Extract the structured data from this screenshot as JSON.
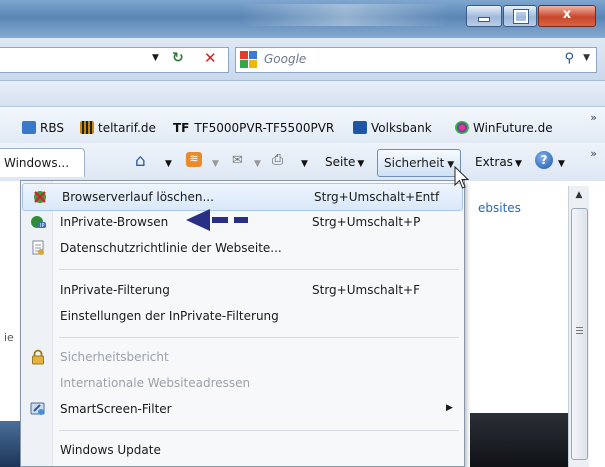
{
  "window": {
    "minimize_glyph": "—",
    "maximize_glyph": "□",
    "close_glyph": "x"
  },
  "address": {
    "refresh_icon": "refresh-icon",
    "stop_icon": "stop-icon"
  },
  "search": {
    "placeholder": "Google",
    "go_glyph": "⚲",
    "dropdown_glyph": "▼"
  },
  "favorites": {
    "items": [
      {
        "label": "RBS",
        "icon": "ie-page-icon",
        "color": "#3a78c9"
      },
      {
        "label": "teltarif.de",
        "icon": "teltarif-icon",
        "color": "#c68a12"
      },
      {
        "label": "TF5000PVR-TF5500PVR",
        "icon": "tf-icon",
        "prefix": "TF"
      },
      {
        "label": "Volksbank",
        "icon": "volksbank-icon",
        "color": "#1f55a6"
      },
      {
        "label": "WinFuture.de",
        "icon": "winfuture-icon",
        "color": "#7b3fa0"
      }
    ],
    "more_glyph": "»"
  },
  "command_bar": {
    "tab_label": "Windows...",
    "seite": "Seite",
    "sicherheit": "Sicherheit",
    "extras": "Extras",
    "more_glyph": "»"
  },
  "page": {
    "partial_text": "ebsites",
    "partial_left": "ie"
  },
  "menu": {
    "items": [
      {
        "label": "Browserverlauf löschen...",
        "shortcut": "Strg+Umschalt+Entf",
        "icon": "delete-history-icon",
        "enabled": true,
        "selected": true
      },
      {
        "label": "InPrivate-Browsen",
        "shortcut": "Strg+Umschalt+P",
        "icon": "inprivate-icon",
        "enabled": true
      },
      {
        "label": "Datenschutzrichtlinie der Webseite...",
        "shortcut": "",
        "icon": "privacy-policy-icon",
        "enabled": true
      },
      {
        "label": "InPrivate-Filterung",
        "shortcut": "Strg+Umschalt+F",
        "icon": "",
        "enabled": true
      },
      {
        "label": "Einstellungen der InPrivate-Filterung",
        "shortcut": "",
        "icon": "",
        "enabled": true
      },
      {
        "label": "Sicherheitsbericht",
        "shortcut": "",
        "icon": "lock-icon",
        "enabled": false
      },
      {
        "label": "Internationale Websiteadressen",
        "shortcut": "",
        "icon": "",
        "enabled": false
      },
      {
        "label": "SmartScreen-Filter",
        "shortcut": "",
        "icon": "smartscreen-icon",
        "enabled": true,
        "submenu": true
      },
      {
        "label": "Windows Update",
        "shortcut": "",
        "icon": "",
        "enabled": true
      }
    ]
  },
  "colors": {
    "annotation_arrow": "#2a2f86",
    "menu_highlight": "#d9e8fa"
  }
}
